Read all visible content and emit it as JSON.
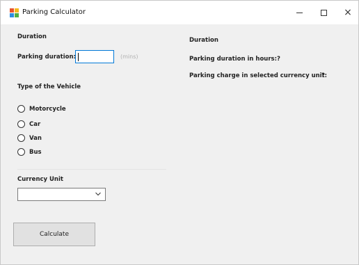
{
  "window": {
    "title": "Parking Calculator",
    "icon": "app-icon",
    "minimize_icon": "minimize-icon",
    "maximize_icon": "maximize-icon",
    "close_glyph": "×"
  },
  "left": {
    "duration_heading": "Duration",
    "parking_duration_label": "Parking duration:",
    "parking_duration_value": "",
    "unit_hint": "(mins)",
    "vehicle_heading": "Type of the Vehicle",
    "vehicle_options": [
      "Motorcycle",
      "Car",
      "Van",
      "Bus"
    ],
    "currency_heading": "Currency Unit",
    "currency_selected": "",
    "calculate_label": "Calculate"
  },
  "right": {
    "duration_heading": "Duration",
    "hours_label": "Parking duration in hours:",
    "hours_value": "?",
    "charge_label": "Parking charge in selected currency unit:",
    "charge_value": "?"
  },
  "colors": {
    "window_bg": "#f0f0f0",
    "input_focus_border": "#0078d7",
    "button_bg": "#e1e1e1"
  }
}
